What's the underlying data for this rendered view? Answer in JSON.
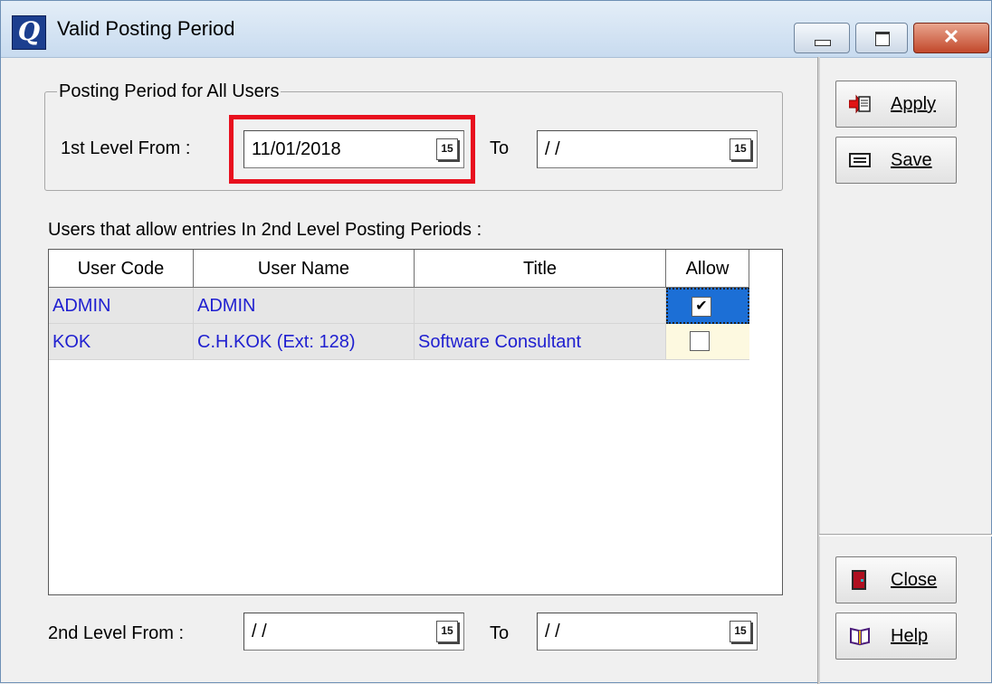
{
  "window": {
    "title": "Valid Posting Period"
  },
  "posting_period_group": {
    "label": "Posting Period for All Users",
    "first_level_from_label": "1st Level From :",
    "first_level_from_value": "11/01/2018",
    "to_label": "To",
    "first_level_to_value": "/ /"
  },
  "users_section_label": "Users that allow entries In 2nd Level Posting Periods :",
  "grid": {
    "columns": [
      "User Code",
      "User Name",
      "Title",
      "Allow"
    ],
    "rows": [
      {
        "user_code": "ADMIN",
        "user_name": "ADMIN",
        "title": "",
        "allow": true
      },
      {
        "user_code": "KOK",
        "user_name": "C.H.KOK (Ext: 128)",
        "title": "Software Consultant",
        "allow": false
      }
    ]
  },
  "second_level": {
    "from_label": "2nd Level From :",
    "from_value": "/ /",
    "to_label": "To",
    "to_value": "/ /"
  },
  "buttons": {
    "apply": "Apply",
    "save": "Save",
    "close": "Close",
    "help": "Help"
  },
  "calendar_icon_text": "15",
  "colors": {
    "highlight": "#e8101e",
    "link_text": "#1f1fd0",
    "selected_cell": "#1c6fd6"
  }
}
